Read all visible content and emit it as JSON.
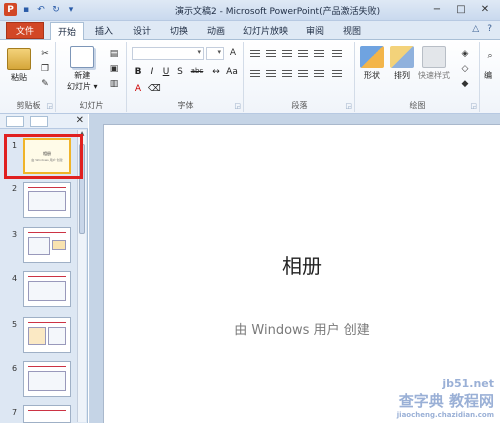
{
  "title_bar": {
    "title": "演示文稿2 - Microsoft PowerPoint(产品激活失败)",
    "app_icon": "P",
    "window_buttons": [
      "−",
      "□",
      "✕"
    ]
  },
  "tabs": {
    "file": "文件",
    "items": [
      "开始",
      "插入",
      "设计",
      "切换",
      "动画",
      "幻灯片放映",
      "审阅",
      "视图"
    ]
  },
  "ribbon": {
    "clipboard": {
      "paste": "粘贴",
      "label": "剪贴板"
    },
    "slides": {
      "new_slide_line1": "新建",
      "new_slide_line2": "幻灯片 ▾",
      "label": "幻灯片"
    },
    "font": {
      "label": "字体",
      "bold": "B",
      "italic": "I",
      "underline": "U",
      "shadow": "S",
      "strike": "abc",
      "font_color": "A"
    },
    "paragraph": {
      "label": "段落"
    },
    "drawing": {
      "shape": "形状",
      "arrange": "排列",
      "quick_styles": "快速样式",
      "label": "绘图"
    },
    "editing": {
      "label": "编"
    }
  },
  "slide_panel": {
    "thumbnails": [
      {
        "num": "1",
        "title": "相册",
        "subtitle": "由 Windows 用户 创建"
      },
      {
        "num": "2"
      },
      {
        "num": "3"
      },
      {
        "num": "4"
      },
      {
        "num": "5"
      },
      {
        "num": "6"
      },
      {
        "num": "7"
      }
    ]
  },
  "slide": {
    "title": "相册",
    "subtitle": "由 Windows 用户 创建"
  },
  "watermark": {
    "line1": "jb51.net",
    "line2": "查字典 教程网",
    "line3": "jiaocheng.chazidian.com"
  },
  "colors": {
    "file_tab": "#d24726",
    "annotation": "#e02020",
    "selected_thumb": "#f0b429"
  }
}
